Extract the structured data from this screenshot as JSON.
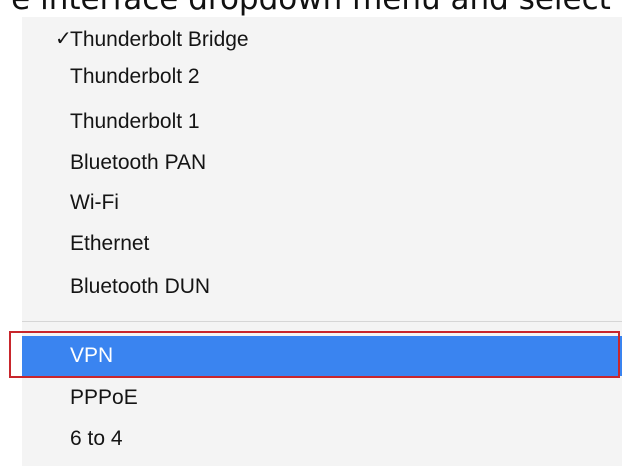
{
  "caption": {
    "text": "e interface dropdown menu and select"
  },
  "menu": {
    "selected_index": 0,
    "highlighted_label": "VPN",
    "items": [
      {
        "label": "Thunderbolt Bridge",
        "checked": true
      },
      {
        "label": "Thunderbolt 2"
      },
      {
        "label": "Thunderbolt 1"
      },
      {
        "label": "Bluetooth PAN"
      },
      {
        "label": "Wi-Fi"
      },
      {
        "label": "Ethernet"
      },
      {
        "label": "Bluetooth DUN"
      },
      {
        "label": "VPN",
        "highlighted": true
      },
      {
        "label": "PPPoE"
      },
      {
        "label": "6 to 4"
      }
    ],
    "check_glyph": "✓"
  },
  "colors": {
    "highlight": "#3a84f0",
    "annotation_outline": "#c8262c",
    "menu_background": "#f4f4f4"
  }
}
